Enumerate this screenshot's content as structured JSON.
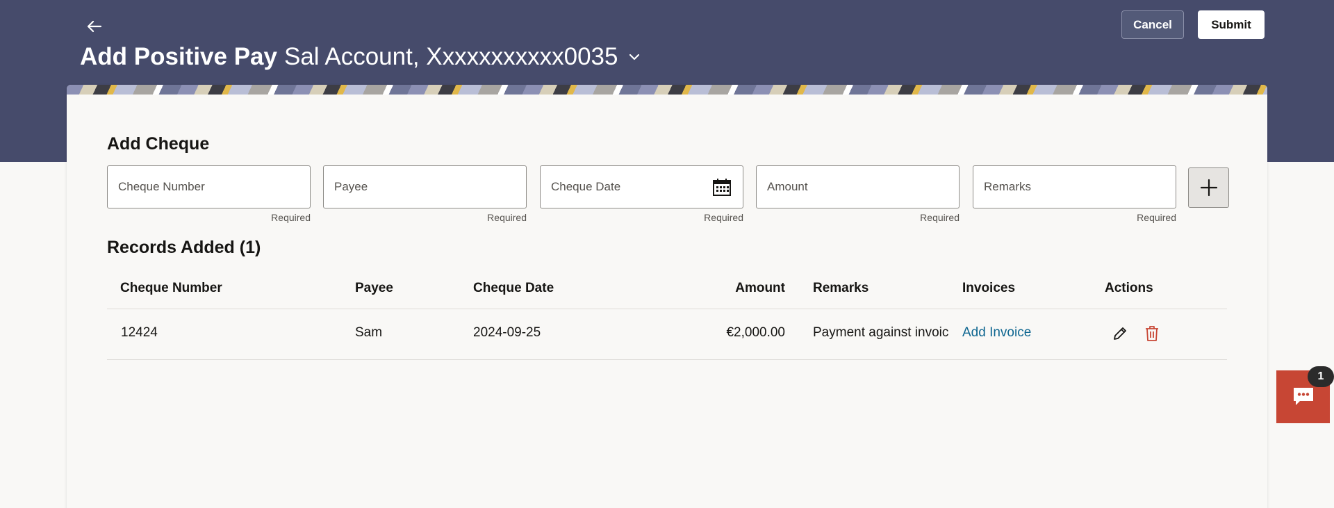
{
  "header": {
    "title": "Add Positive Pay",
    "account": "Sal Account, Xxxxxxxxxxx0035",
    "cancel_label": "Cancel",
    "submit_label": "Submit"
  },
  "add_cheque": {
    "title": "Add Cheque",
    "fields": [
      {
        "placeholder": "Cheque Number",
        "hint": "Required"
      },
      {
        "placeholder": "Payee",
        "hint": "Required"
      },
      {
        "placeholder": "Cheque Date",
        "hint": "Required"
      },
      {
        "placeholder": "Amount",
        "hint": "Required"
      },
      {
        "placeholder": "Remarks",
        "hint": "Required"
      }
    ]
  },
  "records": {
    "title": "Records Added (1)",
    "columns": [
      "Cheque Number",
      "Payee",
      "Cheque Date",
      "Amount",
      "Remarks",
      "Invoices",
      "Actions"
    ],
    "rows": [
      {
        "cheque_number": "12424",
        "payee": "Sam",
        "cheque_date": "2024-09-25",
        "amount": "€2,000.00",
        "remarks": "Payment against invoice",
        "invoice_link": "Add Invoice"
      }
    ]
  },
  "chat": {
    "badge_count": "1"
  },
  "icons": {
    "back": "arrow-left-icon",
    "account_dropdown": "chevron-down-icon",
    "calendar": "calendar-icon",
    "add": "plus-icon",
    "edit": "pencil-icon",
    "delete": "trash-icon",
    "chat": "chat-bubble-icon"
  },
  "colors": {
    "header_bg": "#464b6b",
    "accent_link": "#0e6690",
    "delete_red": "#c74634",
    "chat_bg": "#c74634"
  }
}
